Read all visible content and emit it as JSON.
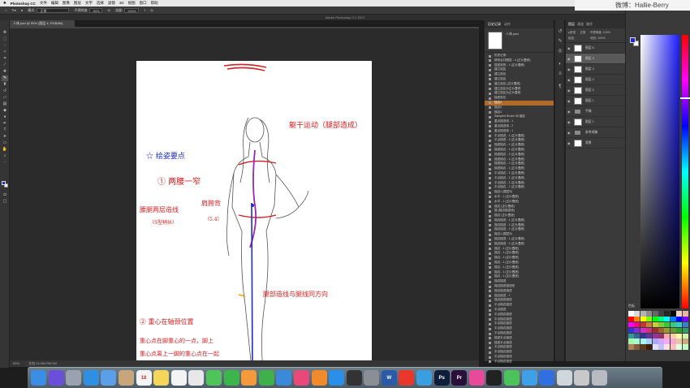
{
  "menubar": {
    "apple": "",
    "app": "Photoshop CC",
    "items": [
      "文件",
      "编辑",
      "图像",
      "图层",
      "文字",
      "选择",
      "滤镜",
      "3D",
      "视图",
      "窗口",
      "帮助"
    ]
  },
  "watermark": "微博：Hallie-Berry",
  "options": {
    "mode_label": "模式:",
    "mode_value": "正常",
    "opacity_label": "不透明度:",
    "opacity_value": "90%",
    "flow_label": "流量:",
    "flow_value": "100%"
  },
  "window_title": "Adobe Photoshop CC 2017",
  "document_tab": "人体.psd @ 50% (图层 4, RGB/8#)",
  "annotations": {
    "top_right": "躯干运动（腿部造成）",
    "key_points": "☆ 绘姿要点",
    "point1": "① 两腰一窄",
    "left_note": "腰腿两层造线",
    "left_note_sub": "（S型稍长）",
    "mid_note": "肩胯背",
    "mid_note_sub": "（5.4）",
    "right_note": "腿部造线与腿线同方向",
    "point2": "② 重心在轴颈位置",
    "bottom_note1": "重心点在脚重心的一点，脚上",
    "bottom_note2": "重心点离上一脚的重心点在一起"
  },
  "status": {
    "zoom": "50%",
    "doc": "文档:34.9M/299.2M"
  },
  "history": {
    "tabs": [
      "历史记录",
      "动作"
    ],
    "snapshot": "人体.psd",
    "items": [
      "历史记录",
      "修改合并图层 - 4 (正片叠底)",
      "描述到的 - 1 (正片叠底)",
      "建立选区",
      "建立选区",
      "建立选区",
      "建立选区 (正片叠底)",
      "建立选区为正片叠底",
      "建立选区为正片叠底",
      "描述到达",
      "描边4",
      "描边2",
      "描边1",
      "Sampled Brush 38 描选",
      "重点描述线 - 1",
      "重点描述线 - 2",
      "重点描述线 - 1",
      "平点描述 - 1 (正片叠底)",
      "平点描述 - 2 (正片叠底)",
      "描述描边 - 1 (正片叠底)",
      "描述描边 - 1 (正片叠底)",
      "描述描边 - 2 (正片叠底)",
      "描述描边 - 1 (正片叠底)",
      "描述描边 - 2 (正片叠底)",
      "描述描边 - 1 (正片叠底)",
      "平点描边 - 1 (正片叠底)",
      "平点描边 - 1 (正片叠底)",
      "平点描边 - 1 (正片叠底)",
      "平点描边 - 1 (正片叠底)",
      "描边1 (图层5)",
      "水平 - 1 (正片叠底)",
      "水平 - 1 (正片叠底)",
      "描边 (正片叠底)",
      "描 (描边描述线)",
      "描边 (正片叠底)",
      "描边描述 - 1 (正片叠底)",
      "描边描述 - 1 (正片叠底)",
      "描边描述 - 1 (正片叠底)",
      "描边1 (图层5)",
      "描边描述 - 1 (正片叠底)",
      "描边描述 - 2 (正片叠底)",
      "描边 - 1 (正片叠底)",
      "描边 - 1 (正片叠底)",
      "描边 - 1 (正片叠底)",
      "描边 - 1 (正片叠底)",
      "描边 - 1 (正片叠底)",
      "描边 - 1 (正片叠底)",
      "描边 - 1 (正片叠底)",
      "描边描述",
      "描边描述描述线",
      "描边描述描述",
      "描边描述 - 1",
      "描边描述描述",
      "平点描边描述",
      "平点描述",
      "平点描边描述",
      "平点描边描述",
      "平点描边描述",
      "平点描边描述",
      "平点描边描述",
      "描述平点描述",
      "描述平点描述",
      "平点描边描述",
      "平点描边描述",
      "平点描边描述",
      "平点描边描述"
    ],
    "active_index": 10
  },
  "layers": {
    "tabs": [
      "图层",
      "通道",
      "路径"
    ],
    "kind_label": "ρ类型",
    "blend": "正常",
    "opacity_label": "不透明度:",
    "opacity": "100%",
    "lock_label": "锁定:",
    "fill_label": "填充:",
    "fill": "100%",
    "rows": [
      {
        "name": "图层 6",
        "kind": "layer"
      },
      {
        "name": "图层 4",
        "kind": "layer"
      },
      {
        "name": "图层 3",
        "kind": "layer"
      },
      {
        "name": "图层 2",
        "kind": "layer"
      },
      {
        "name": "图层 5",
        "kind": "layer"
      },
      {
        "name": "图层 1",
        "kind": "layer"
      },
      {
        "name": "手稿",
        "kind": "group"
      },
      {
        "name": "图层 1",
        "kind": "layer"
      },
      {
        "name": "参考线稿",
        "kind": "group"
      },
      {
        "name": "背景",
        "kind": "layer"
      }
    ],
    "active_index": 1
  },
  "color": {
    "foreground": "#1f2bd1",
    "background": "#ffffff",
    "swatches_title": "色板",
    "swatches": [
      "#ffffff",
      "#d9d9d9",
      "#b3b3b3",
      "#8c8c8c",
      "#666666",
      "#404040",
      "#262626",
      "#000000",
      "#f2d0c4",
      "#e8b8a4",
      "#ff0000",
      "#ff8000",
      "#ffff00",
      "#80ff00",
      "#00ff00",
      "#00ff80",
      "#00ffff",
      "#0080ff",
      "#0000ff",
      "#8000ff",
      "#ff00ff",
      "#ff0080",
      "#cc3333",
      "#cc8033",
      "#cccc33",
      "#80cc33",
      "#33cc33",
      "#33cc80",
      "#33cccc",
      "#3380cc",
      "#3333cc",
      "#8033cc",
      "#cc33cc",
      "#cc3380",
      "#993333",
      "#996633",
      "#999933",
      "#669933",
      "#339933",
      "#339966",
      "#339999",
      "#336699",
      "#333399",
      "#663399",
      "#993399",
      "#993366",
      "#f7a8a8",
      "#f7d0a8",
      "#f7f7a8",
      "#d0f7a8",
      "#a8f7a8",
      "#a8f7d0",
      "#a8f7f7",
      "#a8d0f7",
      "#a8a8f7",
      "#d0a8f7",
      "#f7a8f7",
      "#f7a8d0",
      "#e6c9a8",
      "#c9a882",
      "#a8825c",
      "#825c3a",
      "#5c3a1e",
      "#3a1e0a",
      "#e0e0ff",
      "#c0c0ff",
      "#ffe0e0",
      "#ffc0c0",
      "#e0ffe0",
      "#c0ffc0"
    ]
  },
  "dock": [
    {
      "name": "finder",
      "label": "",
      "color": "#3a8ee6"
    },
    {
      "name": "siri",
      "label": "",
      "color": "#6b4fd8"
    },
    {
      "name": "launchpad",
      "label": "",
      "color": "#9aa3ad"
    },
    {
      "name": "safari",
      "label": "",
      "color": "#2f8fe0"
    },
    {
      "name": "mail",
      "label": "",
      "color": "#5a9fe8"
    },
    {
      "name": "contacts",
      "label": "",
      "color": "#c8a57a"
    },
    {
      "name": "calendar",
      "label": "18",
      "color": "#f4f4f4"
    },
    {
      "name": "notes",
      "label": "",
      "color": "#f5d65a"
    },
    {
      "name": "reminders",
      "label": "",
      "color": "#f4f4f4"
    },
    {
      "name": "photos",
      "label": "",
      "color": "#e8e8e8"
    },
    {
      "name": "messages",
      "label": "",
      "color": "#4fc45a"
    },
    {
      "name": "facetime",
      "label": "",
      "color": "#3cb54a"
    },
    {
      "name": "pages",
      "label": "",
      "color": "#f29a3c"
    },
    {
      "name": "numbers",
      "label": "",
      "color": "#3fb04a"
    },
    {
      "name": "keynote",
      "label": "",
      "color": "#3b8ad9"
    },
    {
      "name": "itunes",
      "label": "",
      "color": "#e8487a"
    },
    {
      "name": "ibooks",
      "label": "",
      "color": "#f08a2a"
    },
    {
      "name": "appstore",
      "label": "",
      "color": "#2a8fe8"
    },
    {
      "name": "quicktime",
      "label": "",
      "color": "#333333"
    },
    {
      "name": "preferences",
      "label": "",
      "color": "#8a8f95"
    },
    {
      "name": "word",
      "label": "W",
      "color": "#2b5aa8"
    },
    {
      "name": "weibo",
      "label": "",
      "color": "#e8382c"
    },
    {
      "name": "cloud",
      "label": "",
      "color": "#3a9fe0"
    },
    {
      "name": "photoshop",
      "label": "Ps",
      "color": "#0e1e3a"
    },
    {
      "name": "premiere",
      "label": "Pr",
      "color": "#2a0f3a"
    },
    {
      "name": "app-pink",
      "label": "",
      "color": "#e84a9a"
    },
    {
      "name": "qq",
      "label": "",
      "color": "#222222"
    },
    {
      "name": "wechat",
      "label": "",
      "color": "#4cc25a"
    },
    {
      "name": "app-w",
      "label": "",
      "color": "#3fa0e8"
    },
    {
      "name": "baidu",
      "label": "",
      "color": "#2f6fe0"
    },
    {
      "name": "preview",
      "label": "",
      "color": "#cfd6dc"
    },
    {
      "name": "documents",
      "label": "",
      "color": "#c8c8c8"
    },
    {
      "name": "trash",
      "label": "",
      "color": "#b8bcc0"
    }
  ]
}
